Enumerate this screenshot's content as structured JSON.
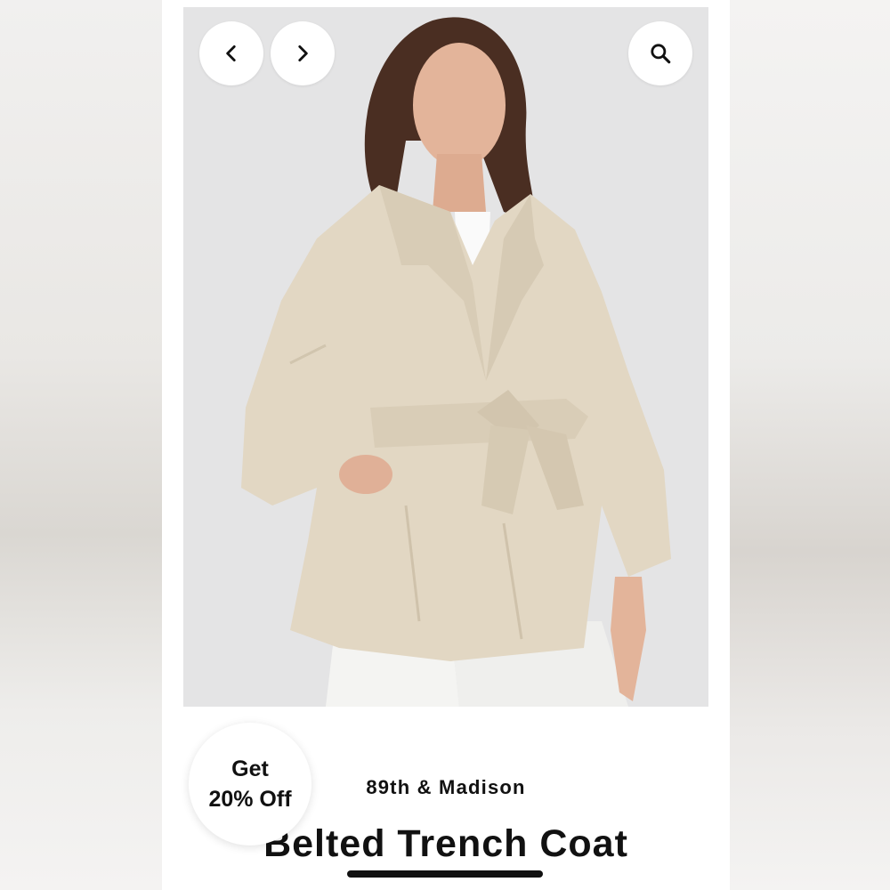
{
  "listing": {
    "brand": "89th & Madison",
    "title": "Belted Trench Coat",
    "photo_alt": "Model wearing a beige belted trench coat"
  },
  "badge": {
    "line1": "Get",
    "line2": "20% Off"
  },
  "icons": {
    "prev": "chevron-left-icon",
    "next": "chevron-right-icon",
    "zoom": "search-icon"
  },
  "colors": {
    "coat": "#e2d7c3",
    "background": "#e4e4e5",
    "text": "#111111"
  }
}
